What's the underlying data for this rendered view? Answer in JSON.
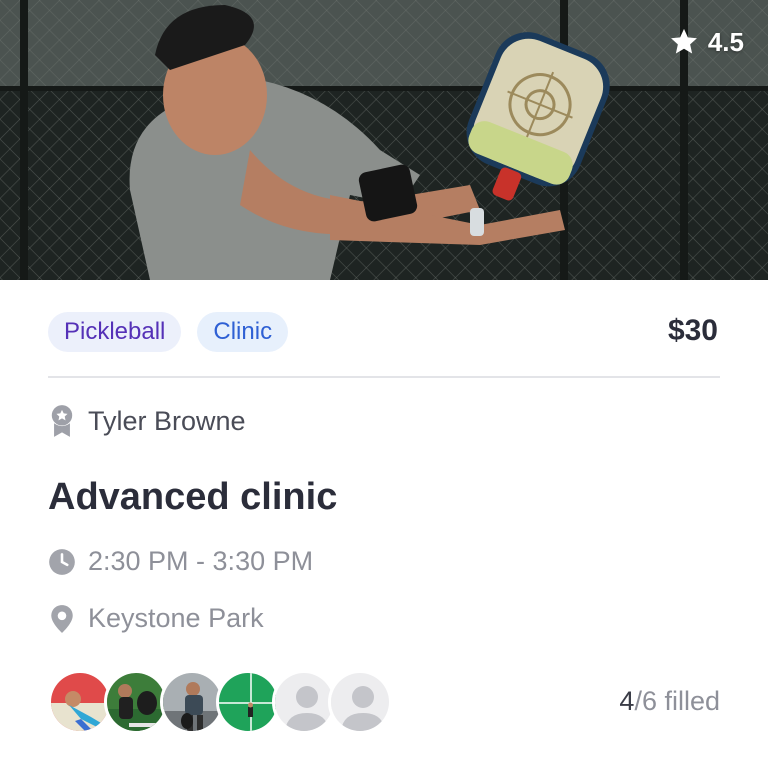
{
  "hero": {
    "image": "pickleball-player-photo"
  },
  "rating": {
    "icon": "star-icon",
    "value": "4.5"
  },
  "tags": {
    "sport": "Pickleball",
    "type": "Clinic"
  },
  "price": "$30",
  "coach": {
    "icon": "award-icon",
    "name": "Tyler Browne"
  },
  "title": "Advanced clinic",
  "time": {
    "icon": "clock-icon",
    "text": "2:30 PM - 3:30 PM"
  },
  "location": {
    "icon": "map-pin-icon",
    "text": "Keystone Park"
  },
  "participants": {
    "avatars": [
      "player-photo",
      "player-photo",
      "player-photo",
      "player-photo",
      "empty-slot",
      "empty-slot"
    ],
    "filled": "4",
    "total_text": "/6 filled"
  },
  "colors": {
    "tag_sport_text": "#5531b7",
    "tag_type_text": "#2f60d4",
    "muted": "#8e9099"
  }
}
